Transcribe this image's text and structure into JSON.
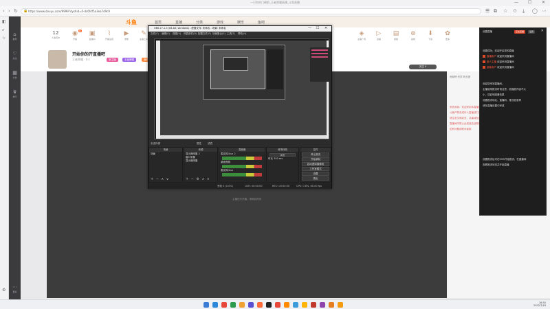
{
  "browser": {
    "window_title": "一只你的门德那_王者荣耀直播_斗鱼直播",
    "url": "https://www.douyu.com/9999?dyshid=0-dc6f4f5a3ea7d9c9",
    "win_min": "—",
    "win_max": "☐",
    "win_close": "✕"
  },
  "site": {
    "logo": "斗鱼",
    "nav": [
      "首页",
      "直播",
      "分类",
      "游戏",
      "娱乐",
      "鱼吧"
    ],
    "toolbar": [
      {
        "label": "12",
        "sub": "人等待中"
      },
      {
        "label": "开播",
        "sub": "",
        "badge": "新"
      },
      {
        "label": "直播间",
        "sub": ""
      },
      {
        "label": "开播设置",
        "sub": ""
      },
      {
        "label": "录像",
        "sub": ""
      },
      {
        "label": "主播工具",
        "sub": ""
      },
      {
        "label": "任务",
        "sub": ""
      },
      {
        "label": "分享",
        "sub": ""
      },
      {
        "label": "福利",
        "sub": ""
      },
      {
        "label": "充值",
        "sub": ""
      }
    ],
    "right_tools": [
      {
        "label": "主播广场"
      },
      {
        "label": "直播"
      },
      {
        "label": "视频"
      },
      {
        "label": "鱼吧"
      },
      {
        "label": "下载"
      },
      {
        "label": "更多"
      }
    ],
    "sidebar": [
      {
        "label": "推荐"
      },
      {
        "label": "关注"
      },
      {
        "label": "分类"
      },
      {
        "label": "排行"
      },
      {
        "label": "更多"
      }
    ],
    "room": {
      "title": "开始你的开直播吧",
      "sub": "王者荣耀 · 0人",
      "tags": [
        "新主播",
        "王者荣耀",
        "我的直播"
      ],
      "follow": "关注 0"
    },
    "player_placeholder": "主播还未开播，请稍后再来",
    "chat_tabs": "贡献榜  贵宾  粉丝团",
    "chat": [
      "系统消息：欢迎来到本直播间",
      "斗鱼严禁未成年人直播或打赏",
      "请注意文明发言，共建绿色直播间",
      "直播间内禁止出现违法违规信息",
      "如有问题请联系客服"
    ]
  },
  "obs": {
    "title": "OBS 27.1.3 (64-bit, windows) - 配置文件: 未命名 - 场景: 未命名",
    "menu": [
      "文件(F)",
      "编辑(E)",
      "视图(V)",
      "停靠部件(D)",
      "配置文件(P)",
      "场景集合(S)",
      "工具(T)",
      "帮助(H)"
    ],
    "status_row": [
      "未选择源",
      "属性",
      "滤镜"
    ],
    "docks": {
      "scenes": {
        "title": "场景",
        "items": [
          "场景"
        ]
      },
      "sources": {
        "title": "来源",
        "items": [
          "显示器采集 2",
          "窗口采集",
          "显示器采集"
        ]
      },
      "mixer": {
        "title": "混音器",
        "items": [
          "麦克风/Aux 2",
          "桌面音频",
          "麦克风/Aux"
        ],
        "level": "0.0 dB"
      },
      "transitions": {
        "title": "转场特效",
        "fade": "淡出",
        "duration": "时长",
        "duration_value": "300 ms"
      },
      "controls": {
        "title": "控件",
        "buttons": [
          "停止推流",
          "开始录制",
          "启动虚拟摄像机",
          "工作室模式",
          "设置",
          "退出"
        ]
      }
    },
    "statusbar": [
      "丢帧 0 (0.0%)",
      "LIVE: 00:00:00",
      "REC: 00:00:00",
      "CPU: 0.8%, 60.00 fps"
    ]
  },
  "notify": {
    "header": "设置直播",
    "pills": [
      "正在直播",
      "设置"
    ],
    "lines": [
      {
        "text": "设置成功，欢迎开启您的直播",
        "mark": false
      },
      {
        "text": "欢迎来到直播间",
        "mark": true,
        "highlight": "直播用户"
      },
      {
        "text": "欢迎来到直播间",
        "mark": true,
        "highlight": "新人主播"
      },
      {
        "text": "欢迎来到直播间",
        "mark": true,
        "highlight": "游客用户"
      },
      {
        "text": "欢迎您来到直播间。",
        "mark": false
      },
      {
        "text": "主播使用推流时请注意，若播放内容不大",
        "mark": false
      },
      {
        "text": "小，将影响观看效果",
        "mark": false
      },
      {
        "text": "设置推流地址、直播码、推流信息等",
        "mark": false
      },
      {
        "text": "请在直播设置中完成",
        "mark": false
      },
      {
        "text": "设置推流后可在OBS开始推流，在直播间",
        "mark": false
      },
      {
        "text": "查看推流状态并开始直播",
        "mark": false
      }
    ]
  },
  "taskbar": {
    "time": "16:50",
    "date": "2022/7/18",
    "app_colors": [
      "#3a7bd5",
      "#2b88d8",
      "#e8483b",
      "#2d9b4d",
      "#f0a030",
      "#5a4fcf",
      "#ff6a3d",
      "#202020",
      "#e8483b",
      "#ff8a00",
      "#3b9bdb",
      "#ffb400",
      "#c0392b",
      "#8e44ad",
      "#e67e22",
      "#f39c12"
    ]
  }
}
